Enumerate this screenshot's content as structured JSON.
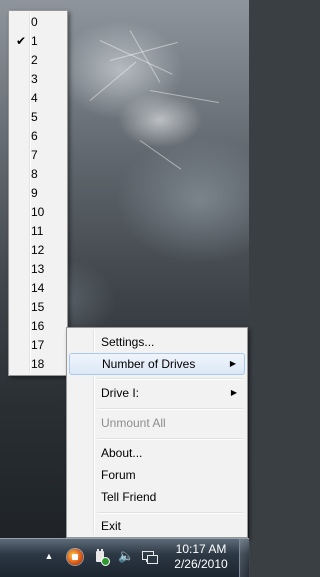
{
  "submenu": {
    "items": [
      "0",
      "1",
      "2",
      "3",
      "4",
      "5",
      "6",
      "7",
      "8",
      "9",
      "10",
      "11",
      "12",
      "13",
      "14",
      "15",
      "16",
      "17",
      "18"
    ],
    "checked_item": "1",
    "check_glyph": "✔"
  },
  "menu": {
    "settings": "Settings...",
    "number_of_drives": "Number of Drives",
    "drive": "Drive I:",
    "unmount_all": "Unmount All",
    "about": "About...",
    "forum": "Forum",
    "tell_friend": "Tell Friend",
    "exit": "Exit",
    "submenu_arrow": "▶"
  },
  "taskbar": {
    "tray_arrow": "▲",
    "speaker_glyph": "🔈",
    "time": "10:17 AM",
    "date": "2/26/2010"
  }
}
